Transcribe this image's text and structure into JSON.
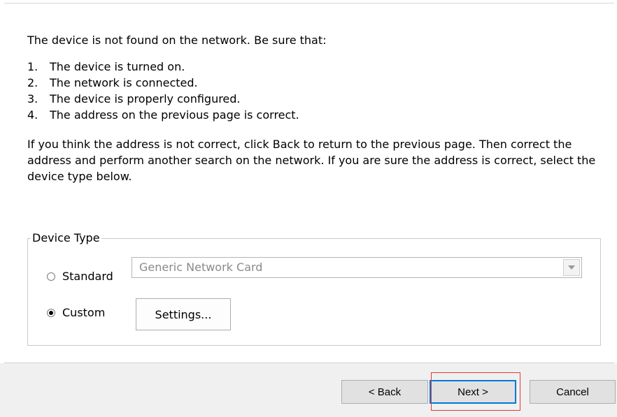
{
  "message": {
    "intro": "The device is not found on the network.  Be sure that:",
    "steps": [
      {
        "num": "1.",
        "text": "The device is turned on."
      },
      {
        "num": "2.",
        "text": "The network is connected."
      },
      {
        "num": "3.",
        "text": "The device is properly configured."
      },
      {
        "num": "4.",
        "text": "The address on the previous page is correct."
      }
    ],
    "help": "If you think the address is not correct, click Back to return to the previous page.  Then correct the address and perform another search on the network.  If you are sure the address is correct, select the device type below."
  },
  "device_type": {
    "title": "Device Type",
    "standard_label": "Standard",
    "standard_selected": false,
    "standard_value": "Generic Network Card",
    "custom_label": "Custom",
    "custom_selected": true,
    "settings_label": "Settings..."
  },
  "buttons": {
    "back": "< Back",
    "next": "Next >",
    "cancel": "Cancel"
  },
  "colors": {
    "focus_border": "#0078d7",
    "highlight_box": "#e03a3a"
  },
  "icons": {
    "dropdown": "chevron-down-icon"
  }
}
